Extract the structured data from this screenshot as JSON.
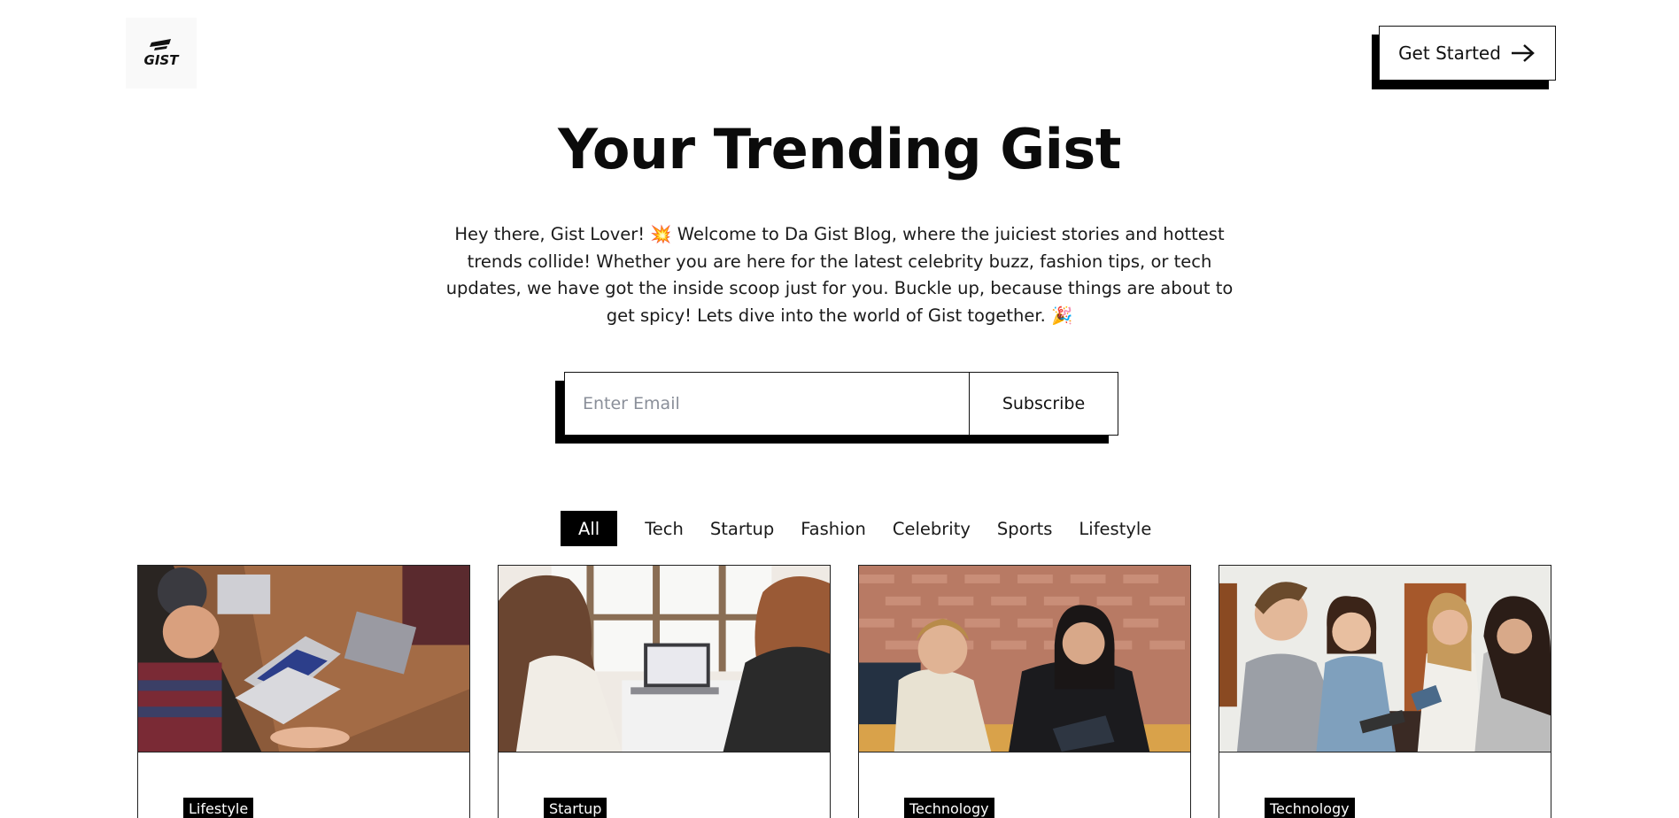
{
  "header": {
    "logo_text": "GIST",
    "cta_label": "Get Started"
  },
  "hero": {
    "title": "Your Trending Gist",
    "description": "Hey there, Gist Lover! 💥 Welcome to Da Gist Blog, where the juiciest stories and hottest trends collide! Whether you are here for the latest celebrity buzz, fashion tips, or tech updates, we have got the inside scoop just for you. Buckle up, because things are about to get spicy! Lets dive into the world of Gist together. 🎉"
  },
  "subscribe": {
    "placeholder": "Enter Email",
    "value": "",
    "button_label": "Subscribe"
  },
  "categories": {
    "active": "All",
    "items": [
      "All",
      "Tech",
      "Startup",
      "Fashion",
      "Celebrity",
      "Sports",
      "Lifestyle"
    ]
  },
  "cards": [
    {
      "tag": "Lifestyle",
      "image": "people working on laptops at wooden table"
    },
    {
      "tag": "Startup",
      "image": "two women at a laptop by a window"
    },
    {
      "tag": "Technology",
      "image": "two women smiling with a tablet"
    },
    {
      "tag": "Technology",
      "image": "group of friends laughing with phones"
    }
  ],
  "colors": {
    "accent": "#000000",
    "background": "#ffffff",
    "text": "#111111",
    "placeholder": "#8a8f99"
  },
  "icons": {
    "cta": "arrow-right-icon"
  }
}
